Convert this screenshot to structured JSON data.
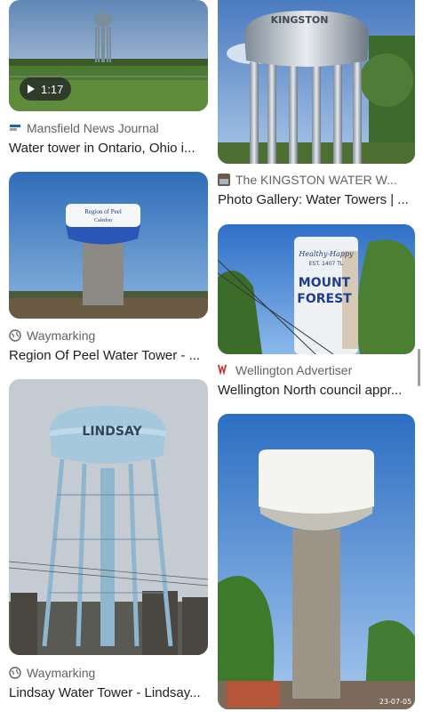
{
  "results": [
    {
      "source": "Mansfield News Journal",
      "title": "Water tower in Ontario, Ohio i...",
      "video_duration": "1:17",
      "favicon": "news-journal-icon"
    },
    {
      "source": "The KINGSTON WATER W...",
      "title": "Photo Gallery: Water Towers | ...",
      "image_text": "KINGSTON",
      "favicon": "kingston-site-icon"
    },
    {
      "source": "Waymarking",
      "title": "Region Of Peel Water Tower - ...",
      "image_text_line1": "Region of Peel",
      "image_text_line2": "Caledon",
      "favicon": "globe-icon"
    },
    {
      "source": "Wellington Advertiser",
      "title": "Wellington North council appr...",
      "image_text_top": "Healthy-Happy",
      "image_text_mid": "EST. 1407 TL",
      "image_text_line1": "MOUNT",
      "image_text_line2": "FOREST",
      "favicon": "wa-logo-icon"
    },
    {
      "source": "Waymarking",
      "title": "Lindsay Water Tower - Lindsay...",
      "image_text": "LINDSAY",
      "favicon": "globe-icon"
    },
    {
      "date_stamp": "23-07-05"
    }
  ],
  "colors": {
    "source_text": "#5f6368",
    "title_text": "#202124",
    "wellington_brand": "#c62828"
  }
}
